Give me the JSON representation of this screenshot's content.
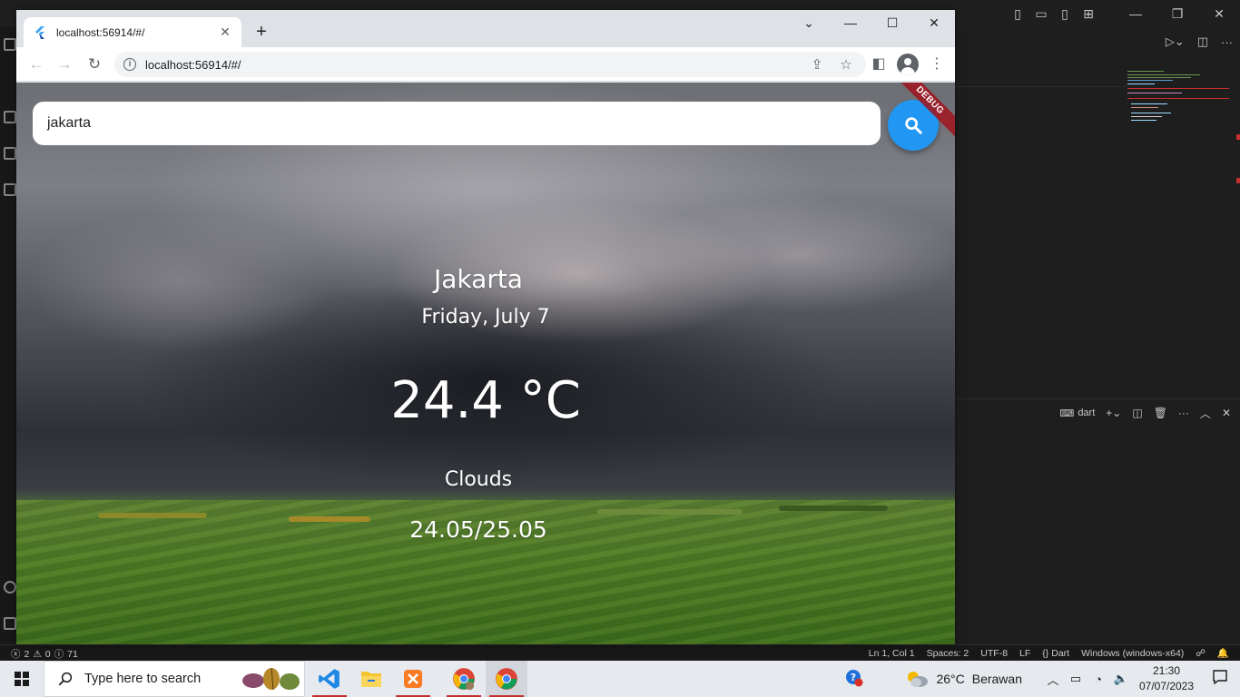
{
  "vscode": {
    "status": {
      "errors": "2",
      "warnings": "0",
      "infos": "71",
      "position": "Ln 1, Col 1",
      "spaces": "Spaces: 2",
      "encoding": "UTF-8",
      "eol": "LF",
      "language": "Dart",
      "platform": "Windows (windows-x64)"
    },
    "terminal_label": "dart"
  },
  "browser": {
    "tab_title": "localhost:56914/#/",
    "url": "localhost:56914/#/"
  },
  "app": {
    "search_value": "jakarta",
    "debug_banner": "DEBUG",
    "city": "Jakarta",
    "date": "Friday, July 7",
    "temperature": "24.4 °C",
    "condition": "Clouds",
    "min_max": "24.05/25.05"
  },
  "taskbar": {
    "search_placeholder": "Type here to search",
    "weather_temp": "26°C",
    "weather_desc": "Berawan",
    "time": "21:30",
    "date": "07/07/2023"
  },
  "colors": {
    "fab_blue": "#2196f3",
    "debug_red": "#a0141e",
    "taskbar_bg": "#e6e9ee",
    "vscode_bg": "#1e1e1e"
  }
}
